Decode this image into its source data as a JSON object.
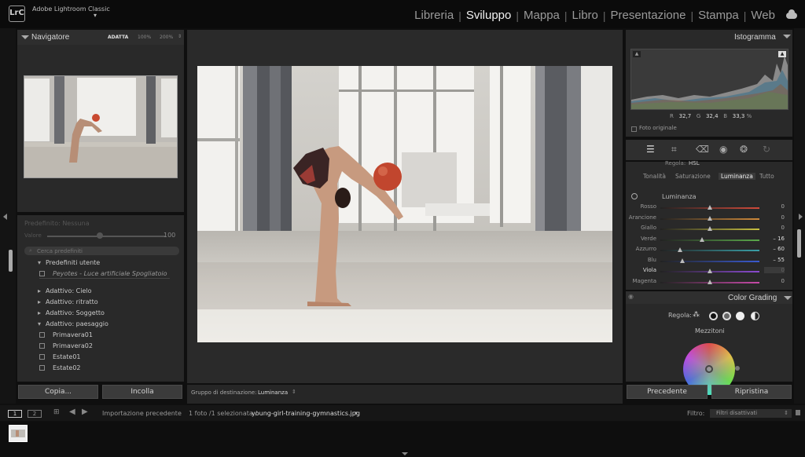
{
  "app": {
    "logo": "LrC",
    "name": "Adobe Lightroom Classic",
    "menu_caret": "▾"
  },
  "modules": [
    "Libreria",
    "Sviluppo",
    "Mappa",
    "Libro",
    "Presentazione",
    "Stampa",
    "Web"
  ],
  "navigator": {
    "title": "Navigatore",
    "zoom": [
      "ADATTA",
      "100%",
      "200%"
    ]
  },
  "preset_preview": {
    "name": "Predefinito: Nessuna",
    "label": "Valore",
    "value": "100"
  },
  "search": {
    "placeholder": "Cerca predefiniti"
  },
  "presets": {
    "groups": [
      {
        "label": "Predefiniti utente",
        "open": true,
        "items": [
          "Peyotes - Luce artificiale Spogliatoio"
        ]
      },
      {
        "label": "Adattivo: Cielo",
        "open": false,
        "items": []
      },
      {
        "label": "Adattivo: ritratto",
        "open": false,
        "items": []
      },
      {
        "label": "Adattivo: Soggetto",
        "open": false,
        "items": []
      },
      {
        "label": "Adattivo: paesaggio",
        "open": true,
        "items": [
          "Primavera01",
          "Primavera02",
          "Estate01",
          "Estate02"
        ]
      }
    ]
  },
  "left_buttons": {
    "copy": "Copia...",
    "paste": "Incolla"
  },
  "toolbar": {
    "target_label": "Gruppo di destinazione:",
    "target_value": "Luminanza"
  },
  "histogram": {
    "title": "Istogramma",
    "r_label": "R",
    "r": "32,7",
    "g_label": "G",
    "g": "32,4",
    "b_label": "B",
    "b": "33,3",
    "unit": "%",
    "original_label": "Foto originale"
  },
  "hsl": {
    "adjust_label": "Regola:",
    "adjust_value": "HSL",
    "tabs": [
      "Tonalità",
      "Saturazione",
      "Luminanza",
      "Tutto"
    ],
    "section_label": "Luminanza",
    "sliders": [
      {
        "label": "Rosso",
        "value": "0",
        "pos": 0.5,
        "color": "#d04a3a"
      },
      {
        "label": "Arancione",
        "value": "0",
        "pos": 0.5,
        "color": "#d08a3a"
      },
      {
        "label": "Giallo",
        "value": "0",
        "pos": 0.5,
        "color": "#c8c040"
      },
      {
        "label": "Verde",
        "value": "– 16",
        "pos": 0.42,
        "color": "#5aa84a"
      },
      {
        "label": "Azzurro",
        "value": "– 60",
        "pos": 0.2,
        "color": "#3aa0a8"
      },
      {
        "label": "Blu",
        "value": "– 55",
        "pos": 0.22,
        "color": "#3a5ad0"
      },
      {
        "label": "Viola",
        "value": "0",
        "pos": 0.5,
        "color": "#8a4ad0"
      },
      {
        "label": "Magenta",
        "value": "0",
        "pos": 0.5,
        "color": "#c84aa8"
      }
    ]
  },
  "color_grading": {
    "title": "Color Grading",
    "adjust_label": "Regola:",
    "subtitle": "Mezzitoni"
  },
  "right_buttons": {
    "previous": "Precedente",
    "reset": "Ripristina"
  },
  "filmstrip": {
    "pages": [
      "1",
      "2"
    ],
    "source": "Importazione precedente",
    "count": "1 foto /1 selezionata /",
    "filename": "young-girl-training-gymnastics.jpg",
    "filter_label": "Filtro:",
    "filter_value": "Filtri disattivati"
  }
}
